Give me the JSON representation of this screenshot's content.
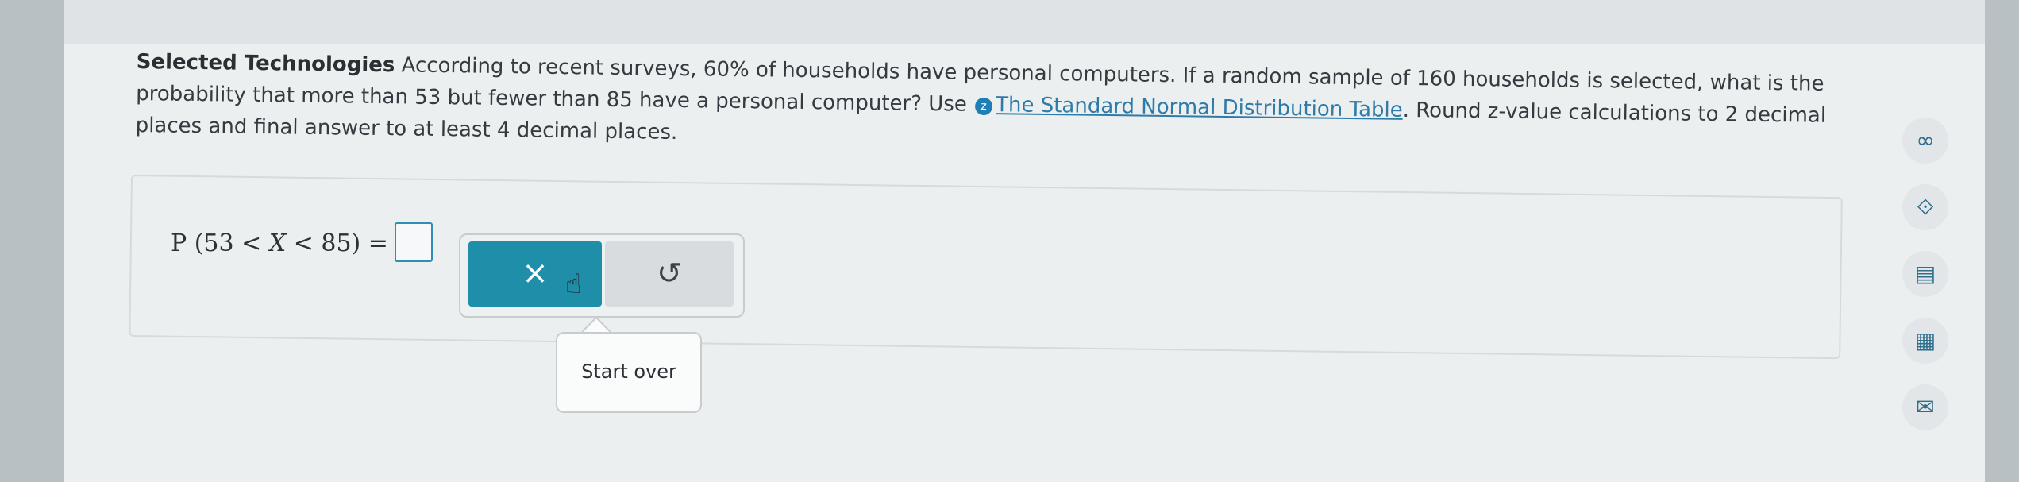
{
  "question": {
    "title": "Selected Technologies",
    "text_before_link": " According to recent surveys, 60% of households have personal computers. If a random sample of 160 households is selected, what is the probability that more than 53 but fewer than 85 have a personal computer? Use ",
    "link_text": "The Standard Normal Distribution Table",
    "text_after_link": ". Round z-value calculations to 2 decimal places and final answer to at least 4 decimal places."
  },
  "answer": {
    "expression_prefix": "P (53 < ",
    "variable": "X",
    "expression_suffix": " < 85) ="
  },
  "toolbar": {
    "clear_label": "×",
    "undo_label": "↺"
  },
  "tooltip": {
    "text": "Start over"
  },
  "side_tools": [
    {
      "icon": "infinity-icon",
      "glyph": "∞"
    },
    {
      "icon": "compass-icon",
      "glyph": "⟐"
    },
    {
      "icon": "notes-icon",
      "glyph": "▤"
    },
    {
      "icon": "calculator-icon",
      "glyph": "▦"
    },
    {
      "icon": "mail-icon",
      "glyph": "✉"
    }
  ]
}
